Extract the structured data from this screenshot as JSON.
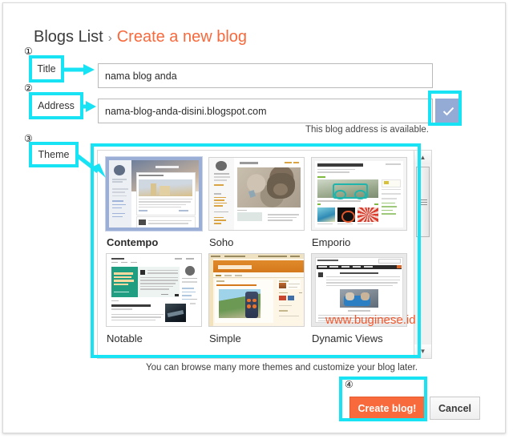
{
  "dialog": {
    "close_icon": "close-icon",
    "breadcrumb": {
      "parent": "Blogs List",
      "separator": "›",
      "current": "Create a new blog",
      "parent_color": "#3b3b3b",
      "current_color": "#f8693c"
    }
  },
  "form": {
    "title": {
      "label": "Title",
      "value": "nama blog anda",
      "placeholder": ""
    },
    "address": {
      "label": "Address",
      "value": "nama-blog-anda-disini.blogspot.com",
      "placeholder": "",
      "availability_note": "This blog address is available.",
      "ok_icon": "check-icon",
      "ok_color": "#94abd6"
    }
  },
  "theme": {
    "label": "Theme",
    "selected": "Contempo",
    "note": "You can browse many more themes and customize your blog later.",
    "items": [
      {
        "name": "Contempo",
        "selected": true,
        "headline": "Mara Luxe Travel"
      },
      {
        "name": "Soho",
        "selected": false,
        "headline": ""
      },
      {
        "name": "Emporio",
        "selected": false,
        "headline": "How Yalma Got Healthy"
      },
      {
        "name": "Notable",
        "selected": false,
        "headline": ""
      },
      {
        "name": "Simple",
        "selected": false,
        "headline": "Simple Blog"
      },
      {
        "name": "Dynamic Views",
        "selected": false,
        "headline": "Dynamic Views"
      }
    ],
    "scrollbar": {
      "up_icon": "triangle-up-icon",
      "down_icon": "triangle-down-icon",
      "grip_icon": "grip-icon"
    }
  },
  "footer": {
    "create_label": "Create blog!",
    "cancel_label": "Cancel",
    "create_color": "#f8693c"
  },
  "annotations": {
    "color": "#17e3f5",
    "markers": [
      {
        "num": "①",
        "label": "Title"
      },
      {
        "num": "②",
        "label": "Address"
      },
      {
        "num": "③",
        "label": "Theme"
      },
      {
        "num": "④",
        "label": ""
      }
    ]
  },
  "watermark": {
    "text": "www.buginese.id",
    "color": "#f4572c"
  }
}
